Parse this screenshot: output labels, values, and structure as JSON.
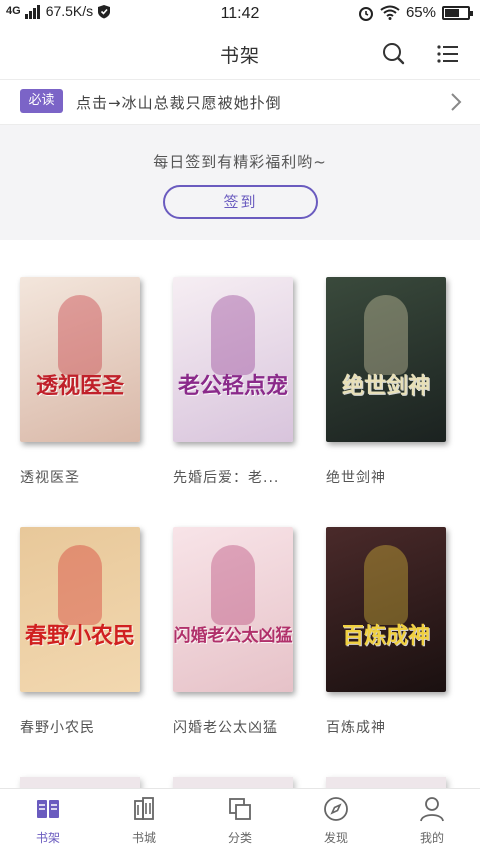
{
  "status_bar": {
    "network": "4G",
    "speed": "67.5K/s",
    "time": "11:42",
    "battery": "65%",
    "battery_level": 0.65
  },
  "header": {
    "title": "书架",
    "search_icon": "search-icon",
    "menu_icon": "list-menu-icon"
  },
  "notice": {
    "badge": "必读",
    "text": "点击→冰山总裁只愿被她扑倒"
  },
  "signin": {
    "prompt": "每日签到有精彩福利哟~",
    "button": "签到"
  },
  "books": [
    {
      "title": "透视医圣",
      "cover_title": "透视医圣",
      "cover_colors": [
        "#f3e6dc",
        "#d9b8a8"
      ],
      "accent": "#c0202a"
    },
    {
      "title": "先婚后爱：老...",
      "cover_title": "老公轻点宠",
      "cover_colors": [
        "#f6eef3",
        "#d8c4dc"
      ],
      "accent": "#8a2a8a"
    },
    {
      "title": "绝世剑神",
      "cover_title": "绝世剑神",
      "cover_colors": [
        "#3a4a3c",
        "#1b2220"
      ],
      "accent": "#e8e0b8"
    },
    {
      "title": "春野小农民",
      "cover_title": "春野小农民",
      "cover_colors": [
        "#e8c89a",
        "#f2d8b0"
      ],
      "accent": "#d02020"
    },
    {
      "title": "闪婚老公太凶猛",
      "cover_title": "闪婚老公太凶猛",
      "cover_colors": [
        "#f8e4e8",
        "#e6c2c8"
      ],
      "accent": "#b0306a"
    },
    {
      "title": "百炼成神",
      "cover_title": "百炼成神",
      "cover_colors": [
        "#4a2a2a",
        "#1a1010"
      ],
      "accent": "#f0d040"
    }
  ],
  "tabs": [
    {
      "label": "书架",
      "icon": "bookshelf-icon",
      "active": true
    },
    {
      "label": "书城",
      "icon": "bookstore-icon",
      "active": false
    },
    {
      "label": "分类",
      "icon": "category-icon",
      "active": false
    },
    {
      "label": "发现",
      "icon": "compass-icon",
      "active": false
    },
    {
      "label": "我的",
      "icon": "profile-icon",
      "active": false
    }
  ],
  "colors": {
    "accent": "#6a5bbf",
    "badge": "#7b64c7"
  }
}
